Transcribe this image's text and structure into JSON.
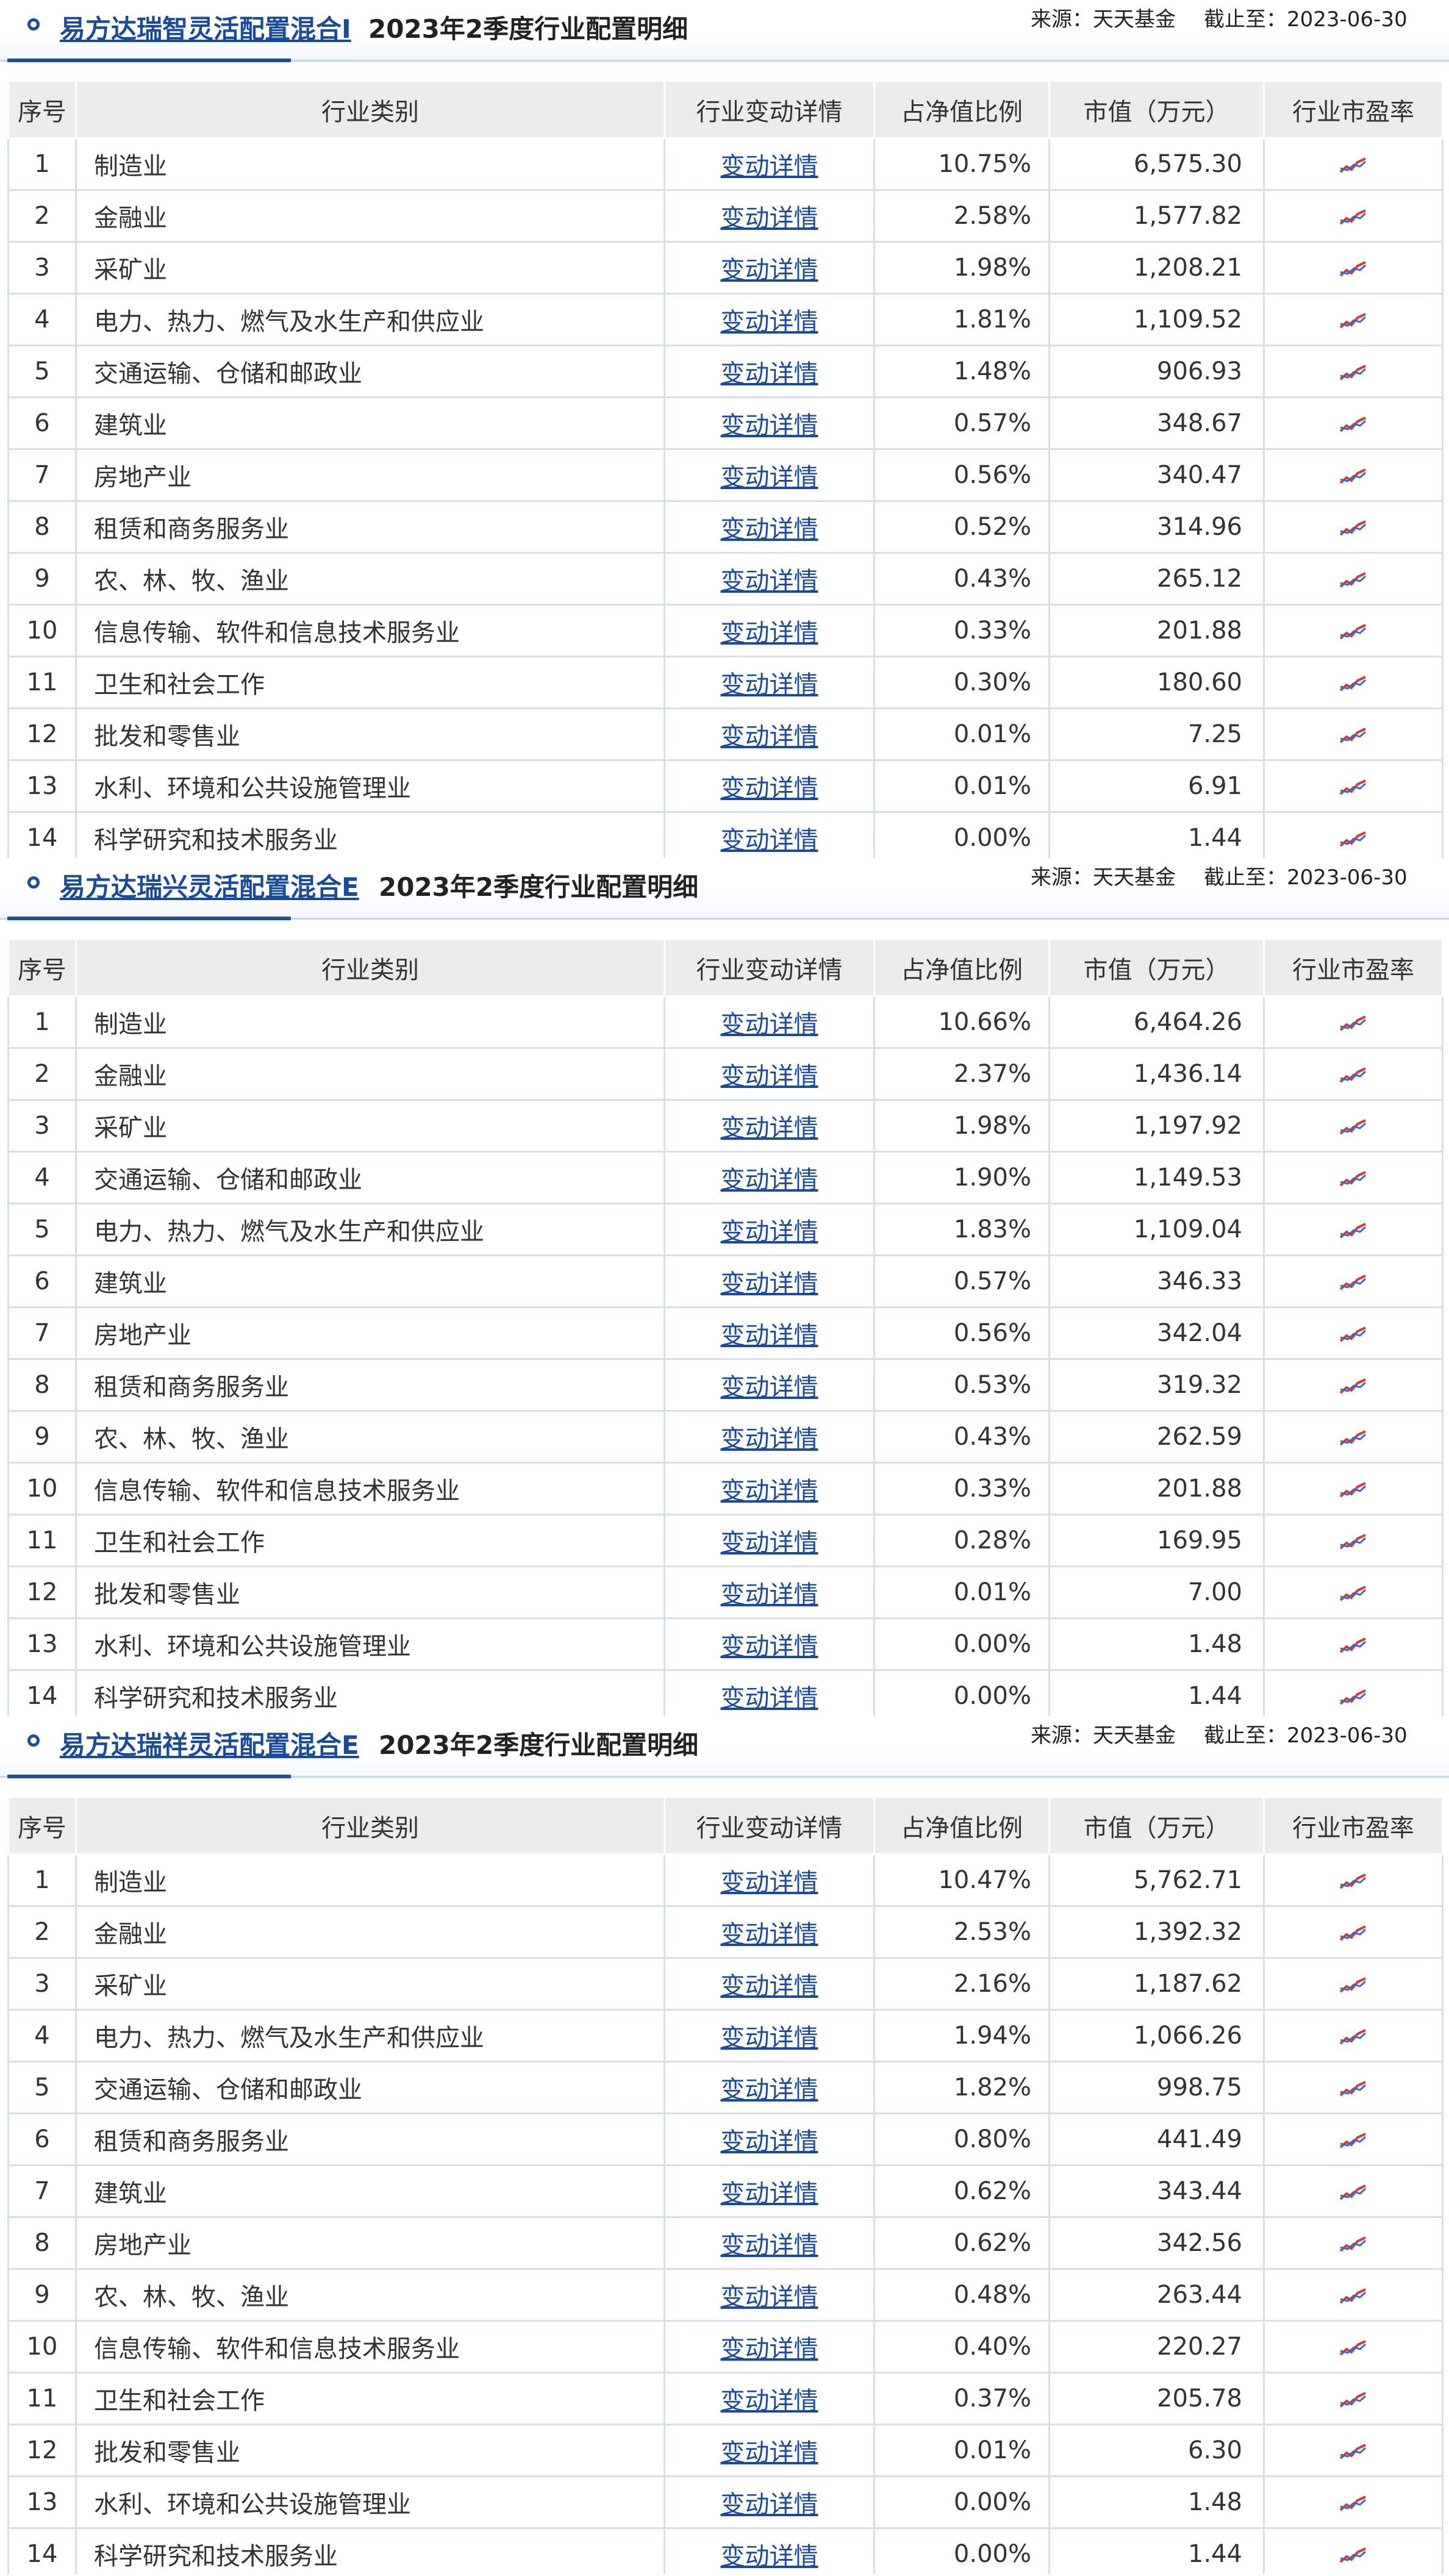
{
  "source_label": "来源：天天基金",
  "date_label": "截止至：2023-06-30",
  "report_title": "2023年2季度行业配置明细",
  "columns": [
    "序号",
    "行业类别",
    "行业变动详情",
    "占净值比例",
    "市值（万元）",
    "行业市盈率"
  ],
  "detail_link_label": "变动详情",
  "colors": {
    "link": "#1a4a9a",
    "header_bg": "#ececec",
    "border": "#d7dfe9",
    "accent": "#1d4f91"
  },
  "funds": [
    {
      "name": "易方达瑞智灵活配置混合I",
      "rows": [
        {
          "no": "1",
          "industry": "制造业",
          "ratio": "10.75%",
          "value": "6,575.30"
        },
        {
          "no": "2",
          "industry": "金融业",
          "ratio": "2.58%",
          "value": "1,577.82"
        },
        {
          "no": "3",
          "industry": "采矿业",
          "ratio": "1.98%",
          "value": "1,208.21"
        },
        {
          "no": "4",
          "industry": "电力、热力、燃气及水生产和供应业",
          "ratio": "1.81%",
          "value": "1,109.52"
        },
        {
          "no": "5",
          "industry": "交通运输、仓储和邮政业",
          "ratio": "1.48%",
          "value": "906.93"
        },
        {
          "no": "6",
          "industry": "建筑业",
          "ratio": "0.57%",
          "value": "348.67"
        },
        {
          "no": "7",
          "industry": "房地产业",
          "ratio": "0.56%",
          "value": "340.47"
        },
        {
          "no": "8",
          "industry": "租赁和商务服务业",
          "ratio": "0.52%",
          "value": "314.96"
        },
        {
          "no": "9",
          "industry": "农、林、牧、渔业",
          "ratio": "0.43%",
          "value": "265.12"
        },
        {
          "no": "10",
          "industry": "信息传输、软件和信息技术服务业",
          "ratio": "0.33%",
          "value": "201.88"
        },
        {
          "no": "11",
          "industry": "卫生和社会工作",
          "ratio": "0.30%",
          "value": "180.60"
        },
        {
          "no": "12",
          "industry": "批发和零售业",
          "ratio": "0.01%",
          "value": "7.25"
        },
        {
          "no": "13",
          "industry": "水利、环境和公共设施管理业",
          "ratio": "0.01%",
          "value": "6.91"
        },
        {
          "no": "14",
          "industry": "科学研究和技术服务业",
          "ratio": "0.00%",
          "value": "1.44"
        }
      ]
    },
    {
      "name": "易方达瑞兴灵活配置混合E",
      "rows": [
        {
          "no": "1",
          "industry": "制造业",
          "ratio": "10.66%",
          "value": "6,464.26"
        },
        {
          "no": "2",
          "industry": "金融业",
          "ratio": "2.37%",
          "value": "1,436.14"
        },
        {
          "no": "3",
          "industry": "采矿业",
          "ratio": "1.98%",
          "value": "1,197.92"
        },
        {
          "no": "4",
          "industry": "交通运输、仓储和邮政业",
          "ratio": "1.90%",
          "value": "1,149.53"
        },
        {
          "no": "5",
          "industry": "电力、热力、燃气及水生产和供应业",
          "ratio": "1.83%",
          "value": "1,109.04"
        },
        {
          "no": "6",
          "industry": "建筑业",
          "ratio": "0.57%",
          "value": "346.33"
        },
        {
          "no": "7",
          "industry": "房地产业",
          "ratio": "0.56%",
          "value": "342.04"
        },
        {
          "no": "8",
          "industry": "租赁和商务服务业",
          "ratio": "0.53%",
          "value": "319.32"
        },
        {
          "no": "9",
          "industry": "农、林、牧、渔业",
          "ratio": "0.43%",
          "value": "262.59"
        },
        {
          "no": "10",
          "industry": "信息传输、软件和信息技术服务业",
          "ratio": "0.33%",
          "value": "201.88"
        },
        {
          "no": "11",
          "industry": "卫生和社会工作",
          "ratio": "0.28%",
          "value": "169.95"
        },
        {
          "no": "12",
          "industry": "批发和零售业",
          "ratio": "0.01%",
          "value": "7.00"
        },
        {
          "no": "13",
          "industry": "水利、环境和公共设施管理业",
          "ratio": "0.00%",
          "value": "1.48"
        },
        {
          "no": "14",
          "industry": "科学研究和技术服务业",
          "ratio": "0.00%",
          "value": "1.44"
        }
      ]
    },
    {
      "name": "易方达瑞祥灵活配置混合E",
      "rows": [
        {
          "no": "1",
          "industry": "制造业",
          "ratio": "10.47%",
          "value": "5,762.71"
        },
        {
          "no": "2",
          "industry": "金融业",
          "ratio": "2.53%",
          "value": "1,392.32"
        },
        {
          "no": "3",
          "industry": "采矿业",
          "ratio": "2.16%",
          "value": "1,187.62"
        },
        {
          "no": "4",
          "industry": "电力、热力、燃气及水生产和供应业",
          "ratio": "1.94%",
          "value": "1,066.26"
        },
        {
          "no": "5",
          "industry": "交通运输、仓储和邮政业",
          "ratio": "1.82%",
          "value": "998.75"
        },
        {
          "no": "6",
          "industry": "租赁和商务服务业",
          "ratio": "0.80%",
          "value": "441.49"
        },
        {
          "no": "7",
          "industry": "建筑业",
          "ratio": "0.62%",
          "value": "343.44"
        },
        {
          "no": "8",
          "industry": "房地产业",
          "ratio": "0.62%",
          "value": "342.56"
        },
        {
          "no": "9",
          "industry": "农、林、牧、渔业",
          "ratio": "0.48%",
          "value": "263.44"
        },
        {
          "no": "10",
          "industry": "信息传输、软件和信息技术服务业",
          "ratio": "0.40%",
          "value": "220.27"
        },
        {
          "no": "11",
          "industry": "卫生和社会工作",
          "ratio": "0.37%",
          "value": "205.78"
        },
        {
          "no": "12",
          "industry": "批发和零售业",
          "ratio": "0.01%",
          "value": "6.30"
        },
        {
          "no": "13",
          "industry": "水利、环境和公共设施管理业",
          "ratio": "0.00%",
          "value": "1.48"
        },
        {
          "no": "14",
          "industry": "科学研究和技术服务业",
          "ratio": "0.00%",
          "value": "1.44"
        }
      ]
    }
  ]
}
